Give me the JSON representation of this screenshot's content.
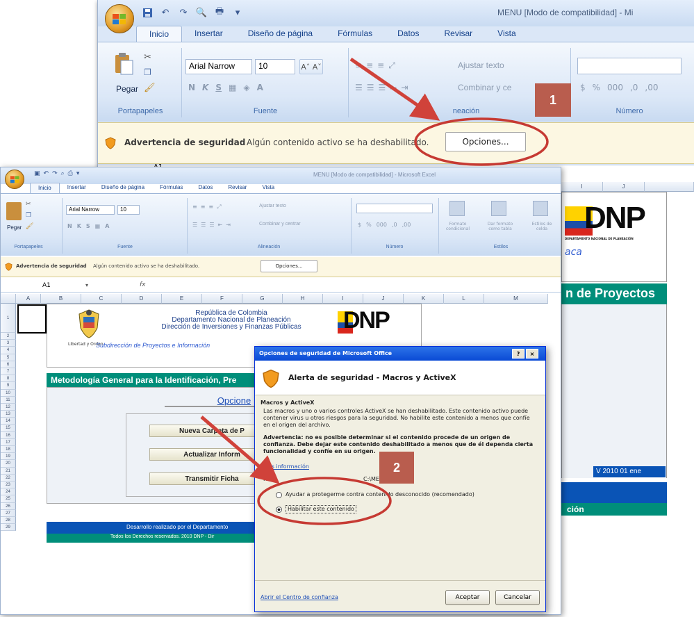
{
  "window_top": {
    "title": "MENU  [Modo de compatibilidad] - Mi",
    "tabs": [
      "Inicio",
      "Insertar",
      "Diseño de página",
      "Fórmulas",
      "Datos",
      "Revisar",
      "Vista"
    ],
    "font_name": "Arial Narrow",
    "font_size": "10",
    "paste_label": "Pegar",
    "wrap_text": "Ajustar texto",
    "merge_center": "Combinar y ce",
    "groups": {
      "clipboard": "Portapapeles",
      "font": "Fuente",
      "alignment": "neación",
      "number": "Número"
    },
    "security": {
      "title": "Advertencia de seguridad",
      "message": "Algún contenido activo se ha deshabilitado.",
      "options": "Opciones..."
    },
    "namebox": "A1"
  },
  "window_bottom": {
    "title": "MENU  [Modo de compatibilidad] - Microsoft Excel",
    "tabs": [
      "Inicio",
      "Insertar",
      "Diseño de página",
      "Fórmulas",
      "Datos",
      "Revisar",
      "Vista"
    ],
    "font_name": "Arial Narrow",
    "font_size": "10",
    "paste_label": "Pegar",
    "wrap_text": "Ajustar texto",
    "merge_center": "Combinar y centrar",
    "format_cond": "Formato condicional",
    "format_table": "Dar formato como tabla",
    "cell_styles": "Estilos de celda",
    "groups": {
      "clipboard": "Portapapeles",
      "font": "Fuente",
      "alignment": "Alineación",
      "number": "Número",
      "styles": "Estilos"
    },
    "security": {
      "title": "Advertencia de seguridad",
      "message": "Algún contenido activo se ha deshabilitado.",
      "options": "Opciones..."
    },
    "namebox": "A1",
    "columns": [
      "A",
      "B",
      "C",
      "D",
      "E",
      "F",
      "G",
      "H",
      "I",
      "J",
      "K",
      "L",
      "M"
    ],
    "rows": [
      "1",
      "2",
      "3",
      "4",
      "5",
      "6",
      "7",
      "8",
      "9",
      "10",
      "11",
      "12",
      "13",
      "14",
      "15",
      "16",
      "17",
      "18",
      "19",
      "20",
      "21",
      "22",
      "23",
      "24",
      "25",
      "26",
      "27",
      "28",
      "29"
    ],
    "sheet": {
      "header_line1": "República de Colombia",
      "header_line2": "Departamento Nacional de Planeación",
      "header_line3": "Dirección de Inversiones y Finanzas Públicas",
      "header_line4": "Subdirección de Proyectos e Información",
      "motto": "Libertad y Orden",
      "dnp": "DNP",
      "banner": "Metodología General para la Identificación, Pre",
      "options_link": "Opcione",
      "btn_new": "Nueva Carpeta de P",
      "btn_update": "Actualizar Inform",
      "btn_transmit": "Transmitir Ficha",
      "footer1": "Desarrollo realizado por el Departamento",
      "footer2": "Todos los Derechos reservados. 2010 DNP - Dir"
    }
  },
  "background_sheet": {
    "columns": [
      "I",
      "J"
    ],
    "dnp": "DNP",
    "dnp_sub": "DEPARTAMENTO NACIONAL DE PLANEACIÓN",
    "link_frag": "aca",
    "banner": "n de Proyectos -",
    "version": "V 2010 01 ene",
    "footer_frag": "ción"
  },
  "dialog": {
    "title": "Opciones de seguridad de Microsoft Office",
    "help": "?",
    "close": "×",
    "heading": "Alerta de seguridad - Macros y ActiveX",
    "section": "Macros y ActiveX",
    "para1": "Las macros y uno o varios controles ActiveX se han deshabilitado. Este contenido activo puede contener virus u otros riesgos para la seguridad. No habilite este contenido a menos que confíe en el origen del archivo.",
    "warning": "Advertencia: no es posible determinar si el contenido procede de un origen de confianza. Debe dejar este contenido deshabilitado a menos que de él dependa cierta funcionalidad y confíe en su origen.",
    "more_info": "Más información",
    "path_label": "Ruta",
    "path_value": "C:\\MENU.XLS",
    "opt_protect": "Ayudar a protegerme contra contenido desconocido (recomendado)",
    "opt_enable": "Habilitar este contenido",
    "trust_center": "Abrir el Centro de confianza",
    "ok": "Aceptar",
    "cancel": "Cancelar"
  },
  "callouts": {
    "step1": "1",
    "step2": "2"
  },
  "colors": {
    "arrow": "#d0423a",
    "badge": "#b95d4e",
    "green_banner": "#008e7a",
    "blue_banner": "#0a54b6"
  }
}
